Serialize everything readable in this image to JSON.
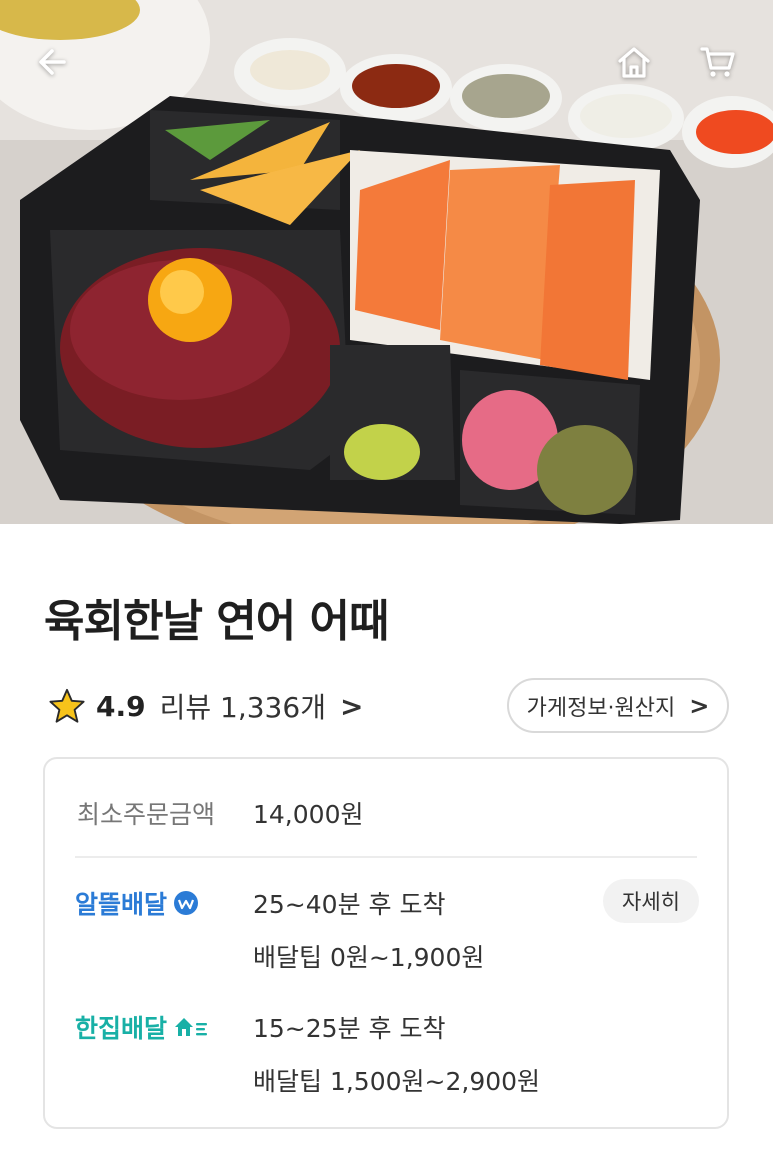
{
  "header": {
    "back_icon": "arrow-left-icon",
    "home_icon": "home-icon",
    "cart_icon": "cart-icon"
  },
  "hero": {
    "image": "salmon-yukhoe-lunchbox-photo"
  },
  "store": {
    "name": "육회한날 연어 어때",
    "rating": "4.9",
    "review_label": "리뷰 1,336개",
    "review_chevron": ">",
    "info_button": "가게정보·원산지",
    "info_chevron": ">"
  },
  "order": {
    "min_order_label": "최소주문금액",
    "min_order_value": "14,000원"
  },
  "delivery": [
    {
      "brand": "알뜰배달",
      "time": "25~40분 후 도착",
      "tip": "배달팁 0원~1,900원",
      "detail_button": "자세히"
    },
    {
      "brand": "한집배달",
      "time": "15~25분 후 도착",
      "tip": "배달팁 1,500원~2,900원"
    }
  ],
  "colors": {
    "brand_blue": "#2b7bd6",
    "brand_teal": "#18b0a6",
    "star": "#f7c31a"
  }
}
